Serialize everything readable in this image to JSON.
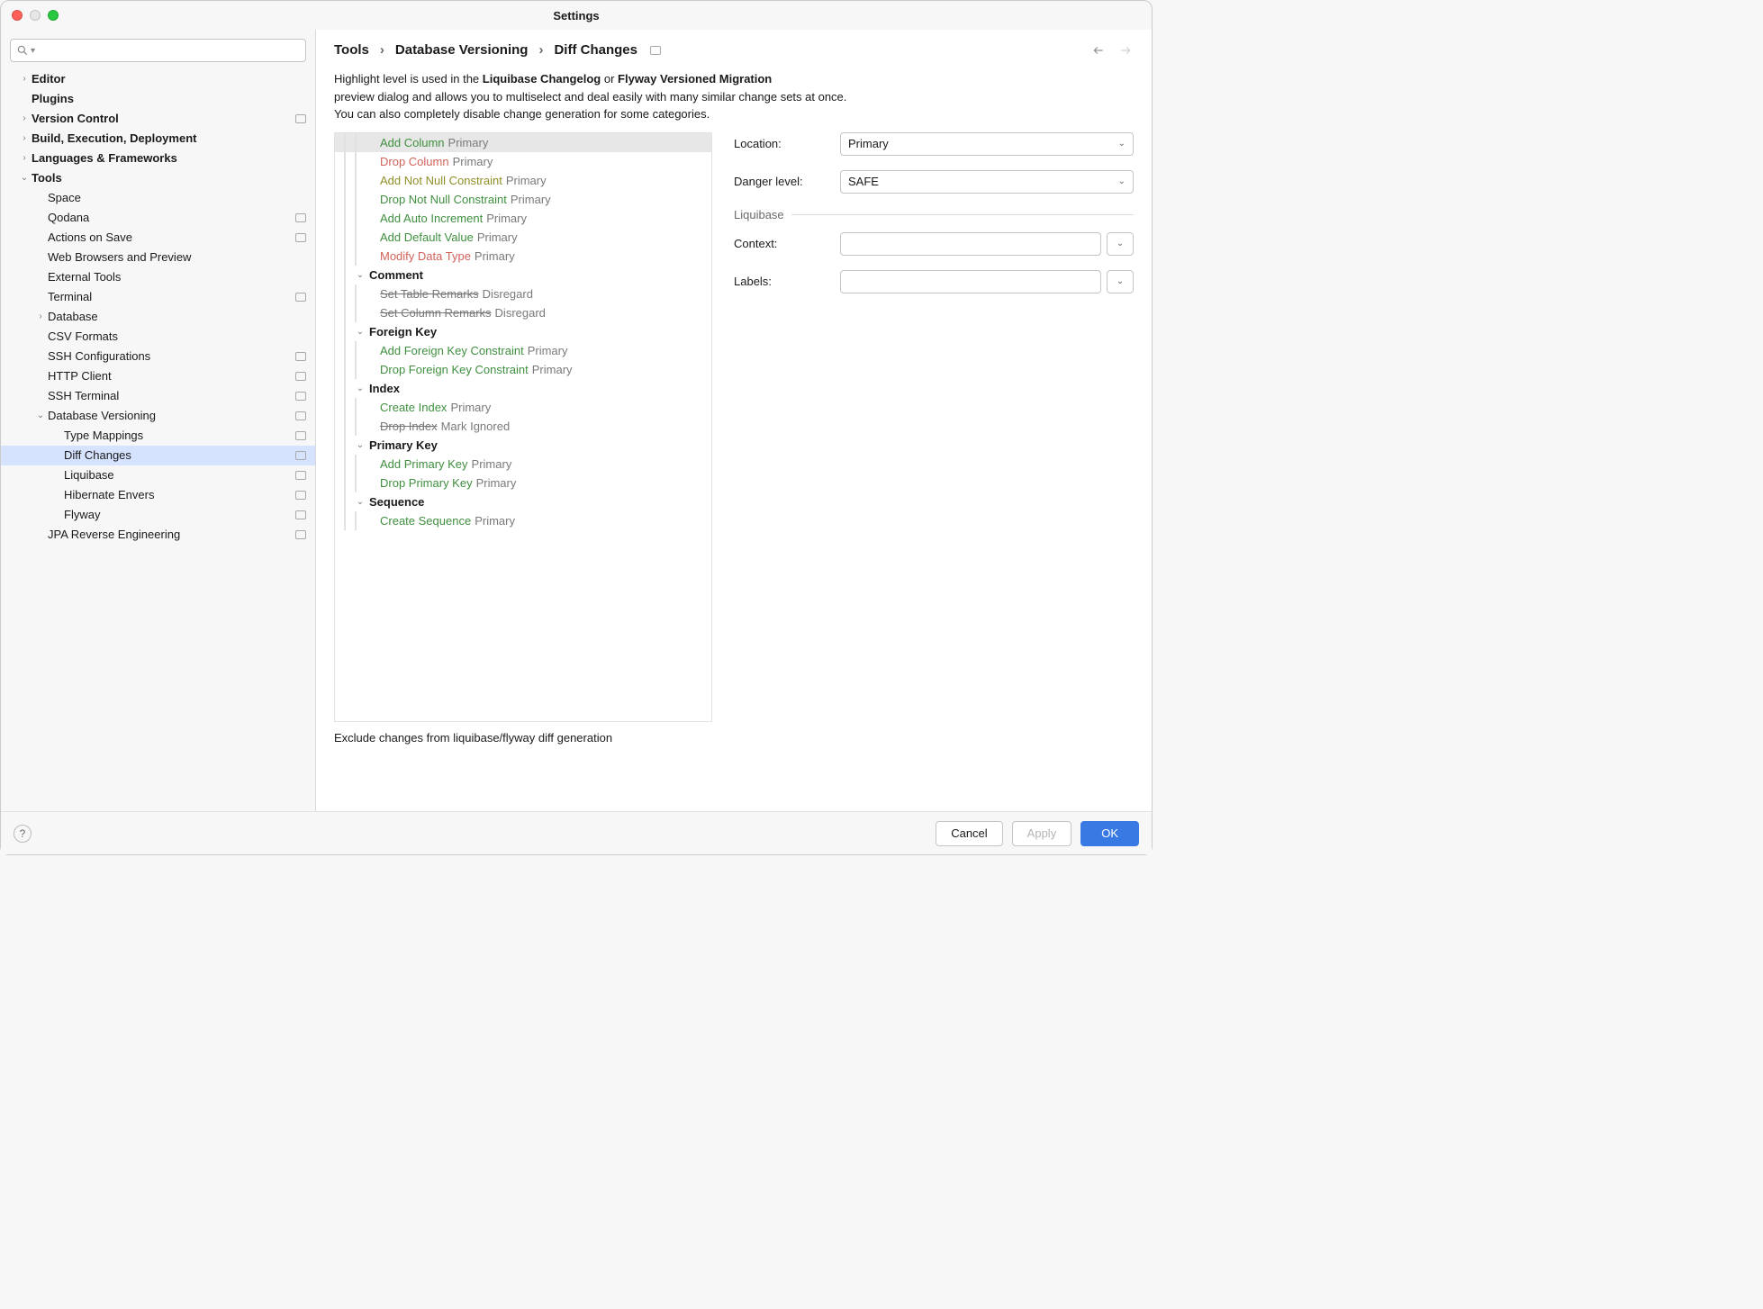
{
  "window": {
    "title": "Settings"
  },
  "search": {
    "placeholder": ""
  },
  "sidebar": [
    {
      "label": "Editor",
      "bold": true,
      "arrow": ">",
      "indent": 0,
      "badge": false
    },
    {
      "label": "Plugins",
      "bold": true,
      "arrow": "",
      "indent": 0,
      "badge": false
    },
    {
      "label": "Version Control",
      "bold": true,
      "arrow": ">",
      "indent": 0,
      "badge": true
    },
    {
      "label": "Build, Execution, Deployment",
      "bold": true,
      "arrow": ">",
      "indent": 0,
      "badge": false
    },
    {
      "label": "Languages & Frameworks",
      "bold": true,
      "arrow": ">",
      "indent": 0,
      "badge": false
    },
    {
      "label": "Tools",
      "bold": true,
      "arrow": "v",
      "indent": 0,
      "badge": false
    },
    {
      "label": "Space",
      "bold": false,
      "arrow": "",
      "indent": 1,
      "badge": false
    },
    {
      "label": "Qodana",
      "bold": false,
      "arrow": "",
      "indent": 1,
      "badge": true
    },
    {
      "label": "Actions on Save",
      "bold": false,
      "arrow": "",
      "indent": 1,
      "badge": true
    },
    {
      "label": "Web Browsers and Preview",
      "bold": false,
      "arrow": "",
      "indent": 1,
      "badge": false
    },
    {
      "label": "External Tools",
      "bold": false,
      "arrow": "",
      "indent": 1,
      "badge": false
    },
    {
      "label": "Terminal",
      "bold": false,
      "arrow": "",
      "indent": 1,
      "badge": true
    },
    {
      "label": "Database",
      "bold": false,
      "arrow": ">",
      "indent": 1,
      "badge": false
    },
    {
      "label": "CSV Formats",
      "bold": false,
      "arrow": "",
      "indent": 1,
      "badge": false
    },
    {
      "label": "SSH Configurations",
      "bold": false,
      "arrow": "",
      "indent": 1,
      "badge": true
    },
    {
      "label": "HTTP Client",
      "bold": false,
      "arrow": "",
      "indent": 1,
      "badge": true
    },
    {
      "label": "SSH Terminal",
      "bold": false,
      "arrow": "",
      "indent": 1,
      "badge": true
    },
    {
      "label": "Database Versioning",
      "bold": false,
      "arrow": "v",
      "indent": 1,
      "badge": true
    },
    {
      "label": "Type Mappings",
      "bold": false,
      "arrow": "",
      "indent": 2,
      "badge": true
    },
    {
      "label": "Diff Changes",
      "bold": false,
      "arrow": "",
      "indent": 2,
      "badge": true,
      "selected": true
    },
    {
      "label": "Liquibase",
      "bold": false,
      "arrow": "",
      "indent": 2,
      "badge": true
    },
    {
      "label": "Hibernate Envers",
      "bold": false,
      "arrow": "",
      "indent": 2,
      "badge": true
    },
    {
      "label": "Flyway",
      "bold": false,
      "arrow": "",
      "indent": 2,
      "badge": true
    },
    {
      "label": "JPA Reverse Engineering",
      "bold": false,
      "arrow": "",
      "indent": 1,
      "badge": true
    }
  ],
  "breadcrumb": {
    "a": "Tools",
    "b": "Database Versioning",
    "c": "Diff Changes"
  },
  "intro": {
    "p1a": "Highlight level is used in the ",
    "p1b": "Liquibase Changelog",
    "p1c": " or ",
    "p1d": "Flyway Versioned Migration",
    "p2": "preview dialog and allows you to multiselect and deal easily with many similar change sets at once.",
    "p3": "You can also completely disable change generation for some categories."
  },
  "tree": [
    {
      "kind": "item",
      "depth": 2,
      "action": "Add Column",
      "cls": "safe",
      "loc": "Primary",
      "selected": true
    },
    {
      "kind": "item",
      "depth": 2,
      "action": "Drop Column",
      "cls": "danger",
      "loc": "Primary"
    },
    {
      "kind": "item",
      "depth": 2,
      "action": "Add Not Null Constraint",
      "cls": "warn",
      "loc": "Primary"
    },
    {
      "kind": "item",
      "depth": 2,
      "action": "Drop Not Null Constraint",
      "cls": "safe",
      "loc": "Primary"
    },
    {
      "kind": "item",
      "depth": 2,
      "action": "Add Auto Increment",
      "cls": "safe",
      "loc": "Primary"
    },
    {
      "kind": "item",
      "depth": 2,
      "action": "Add Default Value",
      "cls": "safe",
      "loc": "Primary"
    },
    {
      "kind": "item",
      "depth": 2,
      "action": "Modify Data Type",
      "cls": "danger",
      "loc": "Primary"
    },
    {
      "kind": "head",
      "depth": 1,
      "label": "Comment"
    },
    {
      "kind": "item",
      "depth": 2,
      "action": "Set Table Remarks",
      "cls": "strike",
      "loc": "Disregard"
    },
    {
      "kind": "item",
      "depth": 2,
      "action": "Set Column Remarks",
      "cls": "strike",
      "loc": "Disregard"
    },
    {
      "kind": "head",
      "depth": 1,
      "label": "Foreign Key"
    },
    {
      "kind": "item",
      "depth": 2,
      "action": "Add Foreign Key Constraint",
      "cls": "safe",
      "loc": "Primary"
    },
    {
      "kind": "item",
      "depth": 2,
      "action": "Drop Foreign Key Constraint",
      "cls": "safe",
      "loc": "Primary"
    },
    {
      "kind": "head",
      "depth": 1,
      "label": "Index"
    },
    {
      "kind": "item",
      "depth": 2,
      "action": "Create Index",
      "cls": "safe",
      "loc": "Primary"
    },
    {
      "kind": "item",
      "depth": 2,
      "action": "Drop Index",
      "cls": "strike",
      "loc": "Mark Ignored"
    },
    {
      "kind": "head",
      "depth": 1,
      "label": "Primary Key"
    },
    {
      "kind": "item",
      "depth": 2,
      "action": "Add Primary Key",
      "cls": "safe",
      "loc": "Primary"
    },
    {
      "kind": "item",
      "depth": 2,
      "action": "Drop Primary Key",
      "cls": "safe",
      "loc": "Primary"
    },
    {
      "kind": "head",
      "depth": 1,
      "label": "Sequence"
    },
    {
      "kind": "item",
      "depth": 2,
      "action": "Create Sequence",
      "cls": "safe",
      "loc": "Primary"
    }
  ],
  "form": {
    "location_label": "Location:",
    "location_value": "Primary",
    "danger_label": "Danger level:",
    "danger_value": "SAFE",
    "liquibase_section": "Liquibase",
    "context_label": "Context:",
    "context_value": "",
    "labels_label": "Labels:",
    "labels_value": ""
  },
  "exclude_label": "Exclude changes from liquibase/flyway diff generation",
  "footer": {
    "cancel": "Cancel",
    "apply": "Apply",
    "ok": "OK"
  }
}
